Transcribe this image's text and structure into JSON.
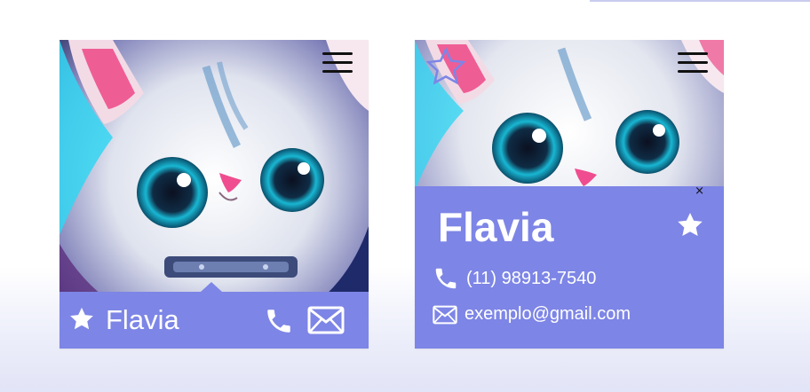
{
  "cards": [
    {
      "name": "Flavia",
      "icons": {
        "menu": "hamburger-menu-icon",
        "favorite": "star-icon",
        "phone": "phone-icon",
        "email": "mail-icon"
      }
    },
    {
      "name": "Flavia",
      "close": "×",
      "phone": "(11) 98913-7540",
      "email": "exemplo@gmail.com",
      "icons": {
        "menu": "hamburger-menu-icon",
        "favorite": "star-icon",
        "favorite_outline": "star-outline-icon",
        "phone": "phone-icon",
        "email": "mail-icon"
      }
    }
  ],
  "colors": {
    "accent": "#7d85e6",
    "text_on_accent": "#ffffff",
    "menu_lines": "#111111"
  }
}
